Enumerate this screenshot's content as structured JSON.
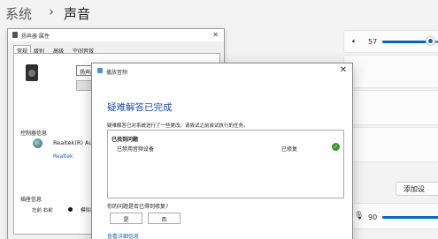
{
  "settings": {
    "breadcrumb_root": "系统",
    "breadcrumb_sep": "›",
    "breadcrumb_page": "声音",
    "output_volume": "57",
    "input_volume": "90",
    "add_button": "添加设"
  },
  "properties": {
    "title": "扬声器 属性",
    "close": "✕",
    "tabs": [
      "常规",
      "级别",
      "高级",
      "空间音效"
    ],
    "name_value": "扬声器",
    "properties_button": "属",
    "controller_label": "控制器信息",
    "controller_name": "Realtek(R) Audio",
    "controller_link": "Realtek",
    "jack_label": "插座信息",
    "jack_lr": "左前 右前",
    "jack_port": "模拟插"
  },
  "troubleshooter": {
    "title": "播放音频",
    "close": "✕",
    "heading": "疑难解答已完成",
    "description": "疑难解答已对系统进行了一些更改。请尝试之前尝试执行的任务。",
    "table_header": "已找到问题",
    "issue_name": "已禁用音频设备",
    "issue_status": "已修复",
    "question": "你的问题是否已得到修复?",
    "yes_button": "是",
    "no_button": "否",
    "details_link": "查看详细信息"
  },
  "colors": {
    "accent": "#0067c0",
    "heading": "#1b4ea1",
    "fixed_check": "#3a9a2a"
  }
}
